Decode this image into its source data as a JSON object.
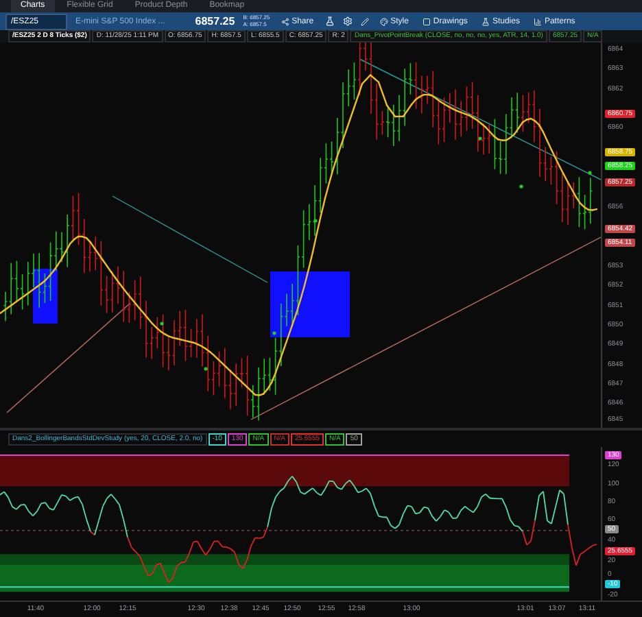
{
  "tabs": [
    {
      "label": "Charts",
      "selected": true
    },
    {
      "label": "Flexible Grid",
      "selected": false
    },
    {
      "label": "Product Depth",
      "selected": false
    },
    {
      "label": "Bookmap",
      "selected": false
    }
  ],
  "toolbar": {
    "symbol": "/ESZ25",
    "description": "E-mini S&P 500 Index ...",
    "last_price": "6857.25",
    "bid": "B: 6857.25",
    "ask": "A: 6857.5",
    "buttons": [
      {
        "label": "Share"
      },
      {
        "label": "Style"
      },
      {
        "label": "Drawings"
      },
      {
        "label": "Studies"
      },
      {
        "label": "Patterns"
      }
    ]
  },
  "info_bar": {
    "title": "/ESZ25 2 D 8 Ticks ($2)",
    "fields": [
      "D: 11/28/25 1:11 PM",
      "O: 6856.75",
      "H: 6857.5",
      "L: 6855.5",
      "C: 6857.25",
      "R: 2"
    ],
    "study": "Dans_PivotPointBreak (CLOSE, no, no, no, yes, ATR, 14, 1.0)",
    "study_values": [
      "6857.25",
      "N/A"
    ]
  },
  "price_axis": {
    "ticks": [
      "6864",
      "6863",
      "6862",
      "6860",
      "6856",
      "6853",
      "6852",
      "6851",
      "6850",
      "6849",
      "6848",
      "6847",
      "6846",
      "6845"
    ],
    "badges": [
      {
        "text": "6860.75",
        "color": "#e0202a"
      },
      {
        "text": "6858.75",
        "color": "#d6b400"
      },
      {
        "text": "6858.25",
        "color": "#19d419"
      },
      {
        "text": "6857.25",
        "color": "#b52a2a"
      },
      {
        "text": "6854.42",
        "color": "#c04848"
      },
      {
        "text": "6854.11",
        "color": "#c04848"
      }
    ]
  },
  "study_panel": {
    "title": "Dans2_BollingerBandsStdDevStudy (yes, 20, CLOSE, 2.0, no)",
    "values": [
      {
        "text": "-10",
        "color": "#3ad6c8"
      },
      {
        "text": "130",
        "color": "#e040d0"
      },
      {
        "text": "N/A",
        "color": "#30c030"
      },
      {
        "text": "N/A",
        "color": "#c03030"
      },
      {
        "text": "25.6555",
        "color": "#e03030"
      },
      {
        "text": "N/A",
        "color": "#30c030"
      },
      {
        "text": "50",
        "color": "#a0a0a0"
      }
    ],
    "ticks": [
      "120",
      "100",
      "80",
      "60",
      "40",
      "20",
      "0",
      "-20"
    ],
    "badges": [
      {
        "text": "130",
        "color": "#e040d0"
      },
      {
        "text": "50",
        "color": "#8a8a8a"
      },
      {
        "text": "25.6555",
        "color": "#e02030"
      },
      {
        "text": "-10",
        "color": "#20c8d8"
      }
    ]
  },
  "time_axis": [
    "11:40",
    "12:00",
    "12:15",
    "12:30",
    "12:38",
    "12:45",
    "12:50",
    "12:55",
    "12:58",
    "13:00",
    "13:01",
    "13:07",
    "13:11"
  ]
}
